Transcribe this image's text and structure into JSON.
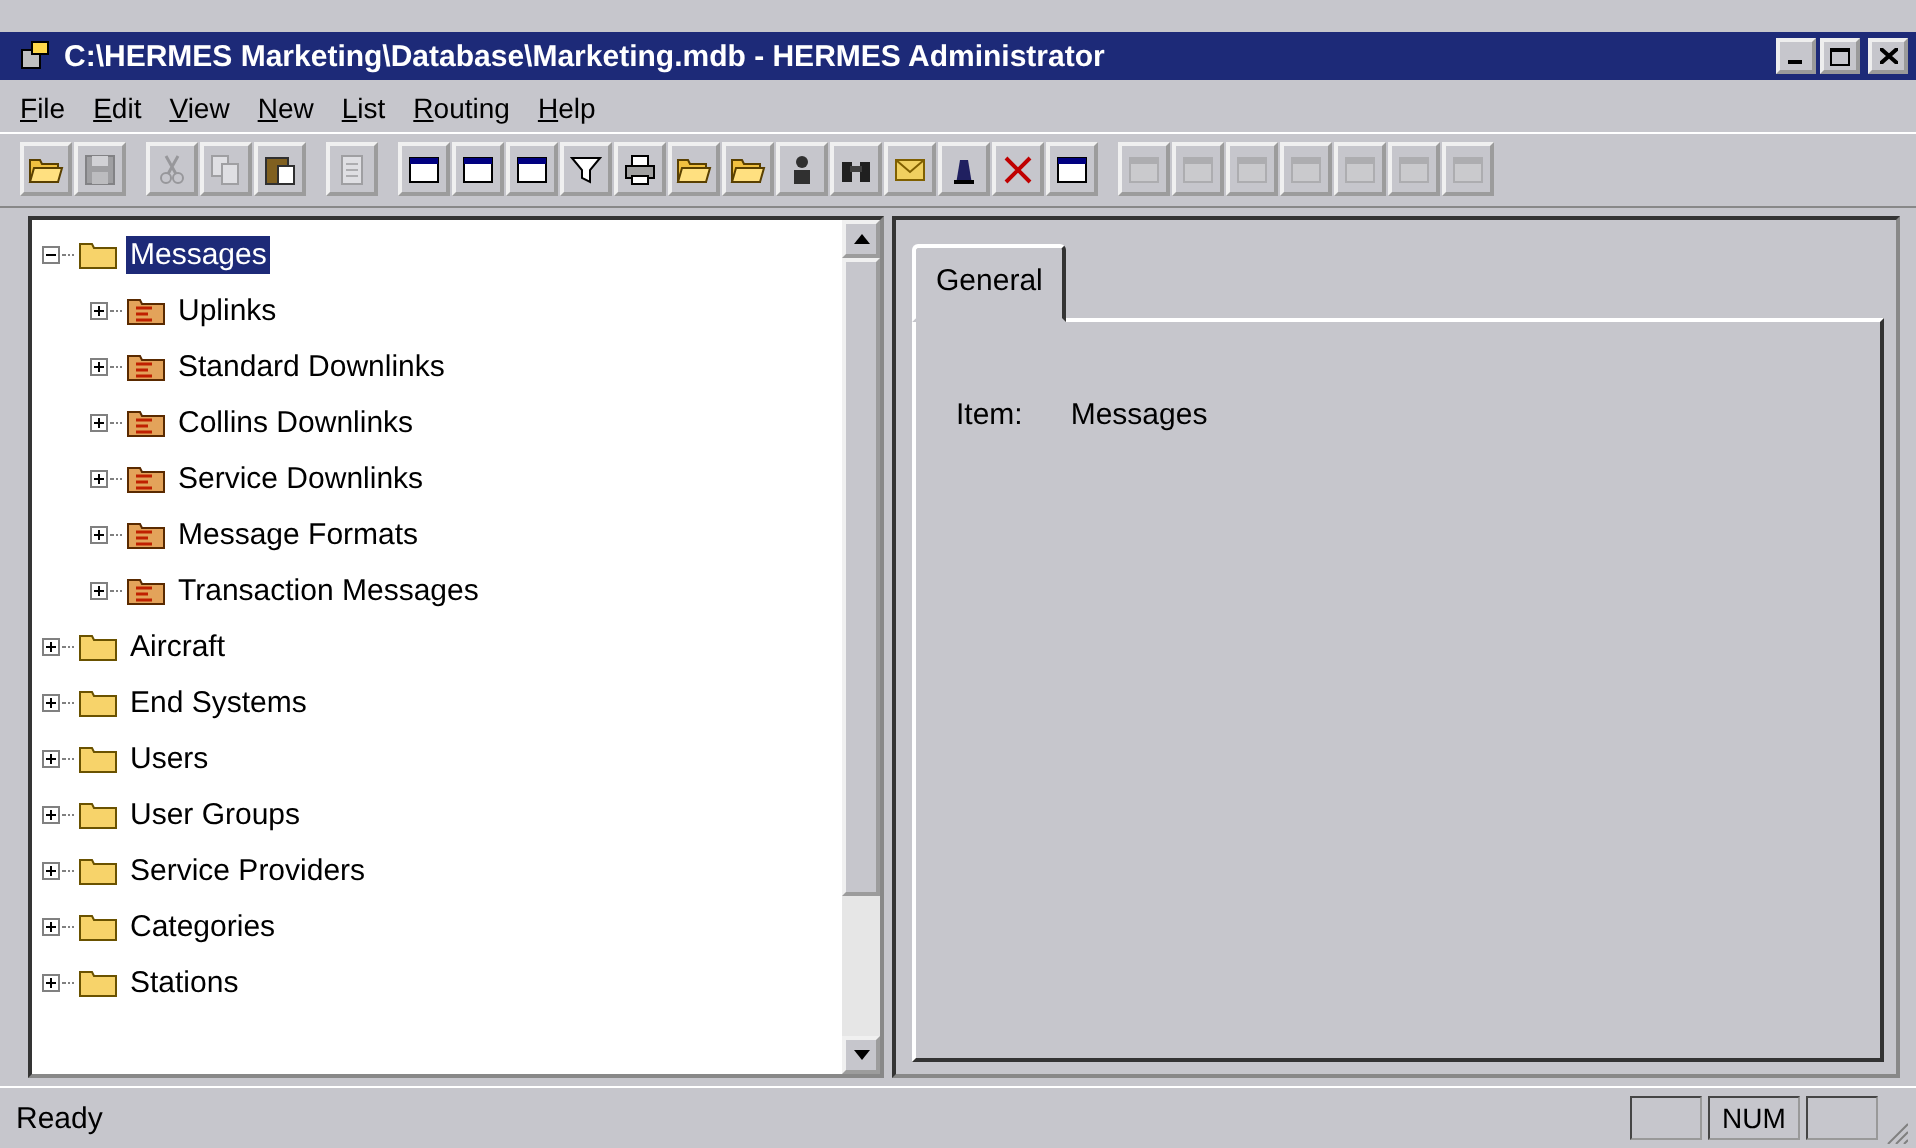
{
  "window": {
    "title": "C:\\HERMES Marketing\\Database\\Marketing.mdb - HERMES Administrator"
  },
  "menu": [
    "File",
    "Edit",
    "View",
    "New",
    "List",
    "Routing",
    "Help"
  ],
  "toolbar": [
    {
      "buttons": [
        {
          "disabled": false
        },
        {
          "disabled": true
        }
      ]
    },
    {
      "buttons": [
        {
          "disabled": true
        },
        {
          "disabled": true
        },
        {
          "disabled": false
        }
      ]
    },
    {
      "buttons": [
        {
          "disabled": true
        }
      ]
    },
    {
      "buttons": [
        {
          "disabled": false
        },
        {
          "disabled": false
        },
        {
          "disabled": false
        },
        {
          "disabled": false
        },
        {
          "disabled": false
        },
        {
          "disabled": false
        },
        {
          "disabled": false
        },
        {
          "disabled": false
        },
        {
          "disabled": false
        },
        {
          "disabled": false
        },
        {
          "disabled": false
        },
        {
          "disabled": false
        },
        {
          "disabled": false
        }
      ]
    },
    {
      "buttons": [
        {
          "disabled": true
        },
        {
          "disabled": true
        },
        {
          "disabled": true
        },
        {
          "disabled": true
        },
        {
          "disabled": true
        },
        {
          "disabled": true
        },
        {
          "disabled": true
        }
      ]
    }
  ],
  "tree": [
    {
      "label": "Messages",
      "selected": true,
      "expanded": true,
      "children": [
        {
          "label": "Uplinks",
          "selected": false,
          "expanded": false
        },
        {
          "label": "Standard Downlinks",
          "selected": false,
          "expanded": false
        },
        {
          "label": "Collins Downlinks",
          "selected": false,
          "expanded": false
        },
        {
          "label": "Service Downlinks",
          "selected": false,
          "expanded": false
        },
        {
          "label": "Message Formats",
          "selected": false,
          "expanded": false
        },
        {
          "label": "Transaction Messages",
          "selected": false,
          "expanded": false
        }
      ]
    },
    {
      "label": "Aircraft",
      "selected": false,
      "expanded": false
    },
    {
      "label": "End Systems",
      "selected": false,
      "expanded": false
    },
    {
      "label": "Users",
      "selected": false,
      "expanded": false
    },
    {
      "label": "User Groups",
      "selected": false,
      "expanded": false
    },
    {
      "label": "Service Providers",
      "selected": false,
      "expanded": false
    },
    {
      "label": "Categories",
      "selected": false,
      "expanded": false
    },
    {
      "label": "Stations",
      "selected": false,
      "expanded": false
    }
  ],
  "tabs": [
    {
      "label": "General",
      "selected": true
    }
  ],
  "details": {
    "label": "Item:",
    "value": "Messages"
  },
  "status_bar": {
    "text": "Ready",
    "indicator": "NUM"
  }
}
